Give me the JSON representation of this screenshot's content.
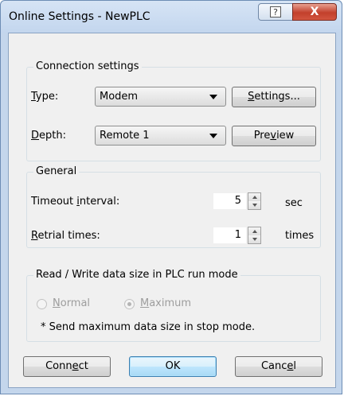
{
  "window": {
    "title": "Online Settings - NewPLC",
    "help_glyph": "?",
    "close_glyph": "X"
  },
  "connection": {
    "group_label": "Connection settings",
    "type_label_u": "T",
    "type_label_rest": "ype:",
    "type_value": "Modem",
    "settings_btn_u": "S",
    "settings_btn_rest": "ettings...",
    "depth_label_u": "D",
    "depth_label_rest": "epth:",
    "depth_value": "Remote 1",
    "preview_btn_pre": "Pre",
    "preview_btn_u": "v",
    "preview_btn_post": "iew"
  },
  "general": {
    "group_label": "General",
    "timeout_label_pre": "Timeout ",
    "timeout_label_u": "i",
    "timeout_label_post": "nterval:",
    "timeout_value": "5",
    "timeout_unit": "sec",
    "retrial_label_u": "R",
    "retrial_label_rest": "etrial times:",
    "retrial_value": "1",
    "retrial_unit": "times"
  },
  "readwrite": {
    "group_label": "Read / Write data size in PLC run mode",
    "normal_u": "N",
    "normal_rest": "ormal",
    "maximum_u": "M",
    "maximum_rest": "aximum",
    "selected": "Maximum",
    "note": "* Send maximum data size in stop mode."
  },
  "footer": {
    "connect_pre": "Conn",
    "connect_u": "e",
    "connect_post": "ct",
    "ok": "OK",
    "cancel_pre": "Canc",
    "cancel_u": "e",
    "cancel_post": "l"
  }
}
